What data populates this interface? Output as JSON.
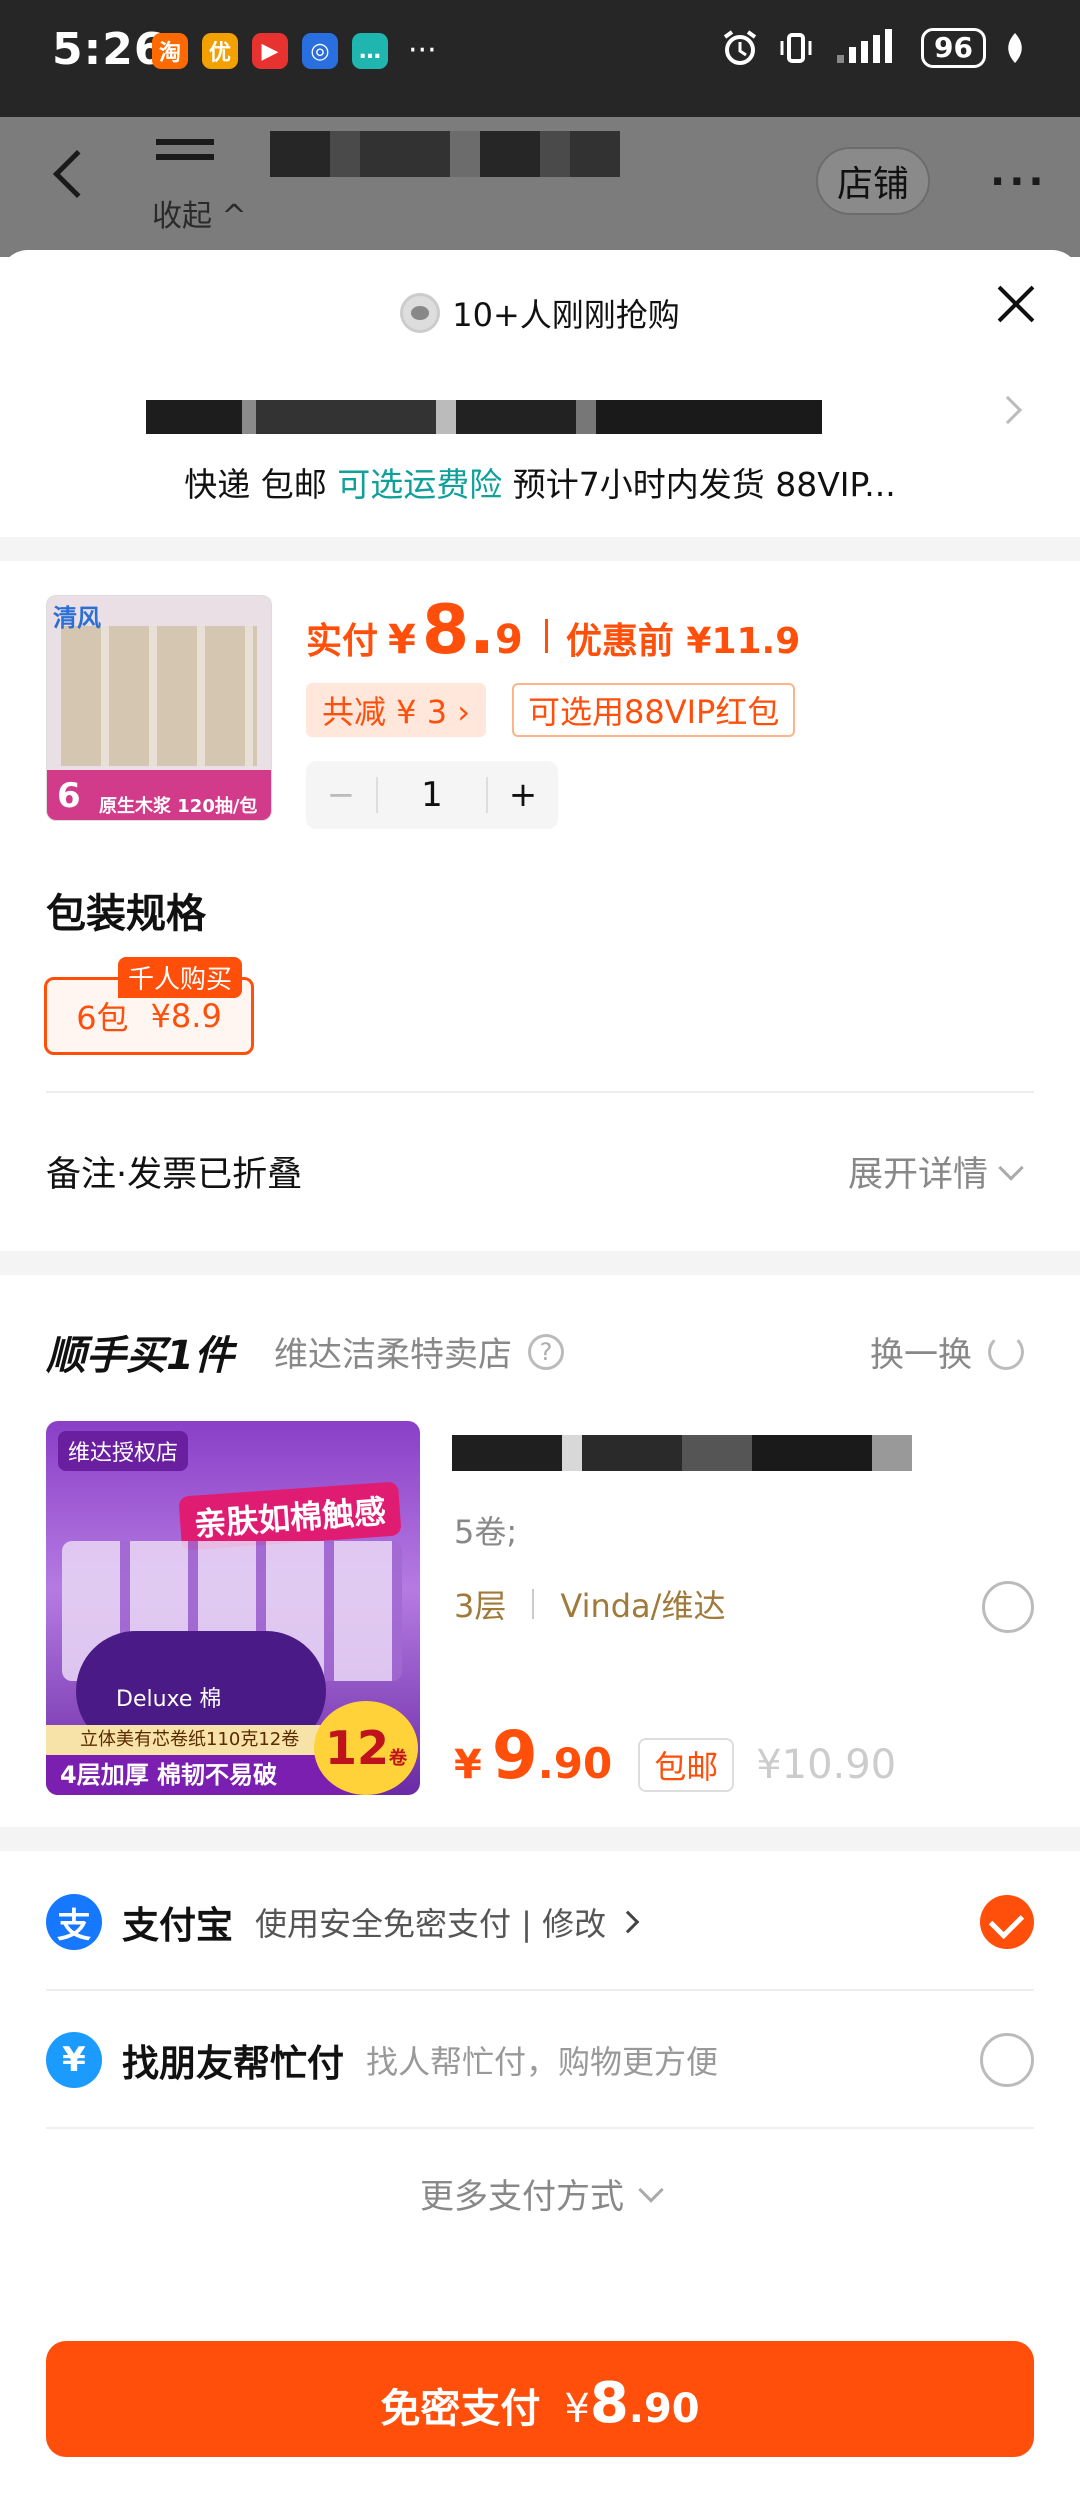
{
  "status_bar": {
    "time": "5:26",
    "apps": [
      {
        "icon": "taobao-app-icon",
        "glyph": "淘",
        "color": "#ff6a00"
      },
      {
        "icon": "game-app-icon",
        "glyph": "优",
        "color": "#f2a100"
      },
      {
        "icon": "video-app-icon",
        "glyph": "▶",
        "color": "#e8322f"
      },
      {
        "icon": "blue-app-icon",
        "glyph": "◎",
        "color": "#2a6fe0"
      },
      {
        "icon": "chat-app-icon",
        "glyph": "…",
        "color": "#1fb6b0"
      }
    ],
    "more": "···",
    "battery": "96"
  },
  "background_page": {
    "collapse_label": "收起 ^",
    "store_label": "店铺",
    "more_label": "···"
  },
  "sheet": {
    "hot_text": "10+人刚刚抢购",
    "shipping": {
      "part1": "快递 包邮 ",
      "green": "可选运费险",
      "part2": " 预计7小时内发货 88VIP..."
    }
  },
  "product": {
    "image_brand": "清风",
    "image_count": "6",
    "image_band_text": "原生木浆 120抽/包",
    "pay_label": "实付",
    "yen": "¥",
    "price_int": "8.",
    "price_dec": "9",
    "pre_price": "优惠前 ¥11.9",
    "discount_tag": "共减 ¥ 3 ›",
    "vip_tag": "可选用88VIP红包",
    "quantity": "1",
    "minus": "−",
    "plus": "+",
    "spec_title": "包装规格",
    "spec_option": {
      "name": "6包",
      "price": "¥8.9"
    },
    "spec_badge": "千人购买",
    "note_label": "备注·发票已折叠",
    "expand_label": "展开详情"
  },
  "addon": {
    "title": "顺手买1件",
    "store": "维达洁柔特卖店",
    "swap_label": "换一换",
    "image": {
      "chip": "维达授权店",
      "headline": "亲肤如棉触感",
      "pack_text": "Deluxe 棉",
      "bottom1": "立体美有芯卷纸110克12卷",
      "bottom2": "4层加厚 棉韧不易破",
      "circle": "12",
      "circle_unit": "卷"
    },
    "spec1": "5卷;",
    "spec2_left": "3层",
    "spec2_right": "Vinda/维达",
    "yen": "¥",
    "price_int": "9",
    "price_dec": ".90",
    "free_shipping": "包邮",
    "orig_price": "¥10.90"
  },
  "payment": {
    "alipay": {
      "name": "支付宝",
      "desc": "使用安全免密支付 | 修改",
      "glyph": "支",
      "selected": true
    },
    "friend": {
      "name": "找朋友帮忙付",
      "desc": "找人帮忙付，购物更方便",
      "glyph": "¥",
      "selected": false
    },
    "more_label": "更多支付方式"
  },
  "bottom": {
    "button_label": "免密支付",
    "yen": "¥",
    "price_int": "8",
    "price_dec": ".90"
  }
}
